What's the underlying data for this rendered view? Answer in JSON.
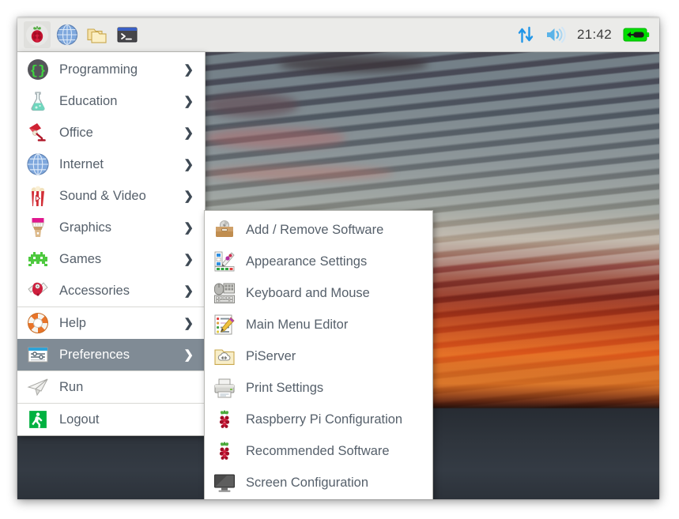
{
  "taskbar": {
    "launchers": [
      {
        "name": "raspberry-menu-button",
        "label": "Raspberry Pi Menu",
        "icon": "raspberry-icon"
      },
      {
        "name": "web-browser-button",
        "label": "Web Browser",
        "icon": "globe-icon"
      },
      {
        "name": "file-manager-button",
        "label": "File Manager",
        "icon": "folder-icon"
      },
      {
        "name": "terminal-button",
        "label": "Terminal",
        "icon": "terminal-icon"
      }
    ],
    "tray": {
      "network_icon": "network-up-down-icon",
      "volume_icon": "speaker-icon",
      "clock": "21:42",
      "battery_icon": "battery-charging-icon"
    },
    "colors": {
      "background": "#ebebe9",
      "network_blue": "#2196e8",
      "battery_green": "#00e000"
    }
  },
  "main_menu": {
    "items": [
      {
        "label": "Programming",
        "icon": "braces-icon",
        "has_arrow": true,
        "selected": false,
        "separator_after": false
      },
      {
        "label": "Education",
        "icon": "flask-icon",
        "has_arrow": true,
        "selected": false,
        "separator_after": false
      },
      {
        "label": "Office",
        "icon": "desk-lamp-icon",
        "has_arrow": true,
        "selected": false,
        "separator_after": false
      },
      {
        "label": "Internet",
        "icon": "globe-icon",
        "has_arrow": true,
        "selected": false,
        "separator_after": false
      },
      {
        "label": "Sound & Video",
        "icon": "popcorn-icon",
        "has_arrow": true,
        "selected": false,
        "separator_after": false
      },
      {
        "label": "Graphics",
        "icon": "paintbrush-icon",
        "has_arrow": true,
        "selected": false,
        "separator_after": false
      },
      {
        "label": "Games",
        "icon": "space-invader-icon",
        "has_arrow": true,
        "selected": false,
        "separator_after": false
      },
      {
        "label": "Accessories",
        "icon": "pocket-knife-icon",
        "has_arrow": true,
        "selected": false,
        "separator_after": true
      },
      {
        "label": "Help",
        "icon": "life-ring-icon",
        "has_arrow": true,
        "selected": false,
        "separator_after": false
      },
      {
        "label": "Preferences",
        "icon": "sliders-icon",
        "has_arrow": true,
        "selected": true,
        "separator_after": false
      },
      {
        "label": "Run",
        "icon": "paper-plane-icon",
        "has_arrow": false,
        "selected": false,
        "separator_after": true
      },
      {
        "label": "Logout",
        "icon": "exit-person-icon",
        "has_arrow": false,
        "selected": false,
        "separator_after": false
      }
    ],
    "selected_highlight_color": "#808b95",
    "text_color": "#56606b"
  },
  "submenu": {
    "parent": "Preferences",
    "items": [
      {
        "label": "Add / Remove Software",
        "icon": "software-toolbox-icon"
      },
      {
        "label": "Appearance Settings",
        "icon": "color-palette-icon"
      },
      {
        "label": "Keyboard and Mouse",
        "icon": "keyboard-mouse-icon"
      },
      {
        "label": "Main Menu Editor",
        "icon": "menu-pencil-icon"
      },
      {
        "label": "PiServer",
        "icon": "cloud-folder-icon"
      },
      {
        "label": "Print Settings",
        "icon": "printer-icon"
      },
      {
        "label": "Raspberry Pi Configuration",
        "icon": "raspberry-icon"
      },
      {
        "label": "Recommended Software",
        "icon": "raspberry-icon"
      },
      {
        "label": "Screen Configuration",
        "icon": "monitor-icon"
      }
    ]
  },
  "desktop": {
    "wallpaper_description": "Sunset over lake with mountain silhouette",
    "sky_color": "#7a848a",
    "cloud_color": "#e04a12"
  }
}
